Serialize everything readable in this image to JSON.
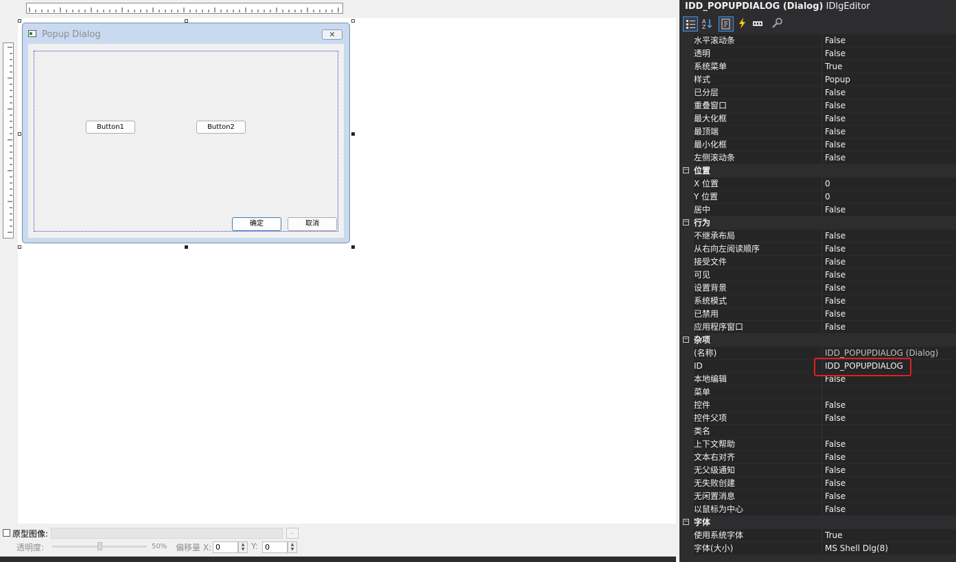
{
  "dialog": {
    "title": "Popup Dialog",
    "close_glyph": "✕",
    "buttons": {
      "button1": "Button1",
      "button2": "Button2",
      "ok": "确定",
      "cancel": "取消"
    }
  },
  "prototype_bar": {
    "checkbox_label": "原型图像:",
    "browse_label": "..",
    "opacity_label": "透明度:",
    "opacity_value": "50%",
    "offset_label": "偏移量 X:",
    "offset_x": "0",
    "y_label": "Y:",
    "offset_y": "0"
  },
  "properties": {
    "header_bold": "IDD_POPUPDIALOG (Dialog)",
    "header_suffix": "IDlgEditor",
    "toolbar_icons": [
      "categorized-icon",
      "alphabetical-icon",
      "properties-icon",
      "events-icon",
      "messages-icon",
      "overrides-icon"
    ],
    "rows": [
      {
        "name": "水平滚动条",
        "value": "False"
      },
      {
        "name": "透明",
        "value": "False"
      },
      {
        "name": "系统菜单",
        "value": "True"
      },
      {
        "name": "样式",
        "value": "Popup"
      },
      {
        "name": "已分层",
        "value": "False"
      },
      {
        "name": "重叠窗口",
        "value": "False"
      },
      {
        "name": "最大化框",
        "value": "False"
      },
      {
        "name": "最顶端",
        "value": "False"
      },
      {
        "name": "最小化框",
        "value": "False"
      },
      {
        "name": "左侧滚动条",
        "value": "False"
      },
      {
        "name": "位置",
        "category": true
      },
      {
        "name": "X 位置",
        "value": "0"
      },
      {
        "name": "Y 位置",
        "value": "0"
      },
      {
        "name": "居中",
        "value": "False"
      },
      {
        "name": "行为",
        "category": true
      },
      {
        "name": "不继承布局",
        "value": "False"
      },
      {
        "name": "从右向左阅读顺序",
        "value": "False"
      },
      {
        "name": "接受文件",
        "value": "False"
      },
      {
        "name": "可见",
        "value": "False"
      },
      {
        "name": "设置背景",
        "value": "False"
      },
      {
        "name": "系统模式",
        "value": "False"
      },
      {
        "name": "已禁用",
        "value": "False"
      },
      {
        "name": "应用程序窗口",
        "value": "False"
      },
      {
        "name": "杂项",
        "category": true
      },
      {
        "name": "(名称)",
        "value": "IDD_POPUPDIALOG (Dialog)",
        "dim": true
      },
      {
        "name": "ID",
        "value": "IDD_POPUPDIALOG"
      },
      {
        "name": "本地编辑",
        "value": "False"
      },
      {
        "name": "菜单",
        "value": ""
      },
      {
        "name": "控件",
        "value": "False"
      },
      {
        "name": "控件父项",
        "value": "False"
      },
      {
        "name": "类名",
        "value": ""
      },
      {
        "name": "上下文帮助",
        "value": "False"
      },
      {
        "name": "文本右对齐",
        "value": "False"
      },
      {
        "name": "无父级通知",
        "value": "False"
      },
      {
        "name": "无失败创建",
        "value": "False"
      },
      {
        "name": "无闲置消息",
        "value": "False"
      },
      {
        "name": "以鼠标为中心",
        "value": "False"
      },
      {
        "name": "字体",
        "category": true
      },
      {
        "name": "使用系统字体",
        "value": "True"
      },
      {
        "name": "字体(大小)",
        "value": "MS Shell Dlg(8)"
      }
    ]
  },
  "colors": {
    "panel_bg": "#2d2d30",
    "highlight_border": "#e02020",
    "guide_line": "#3b3bbf"
  }
}
